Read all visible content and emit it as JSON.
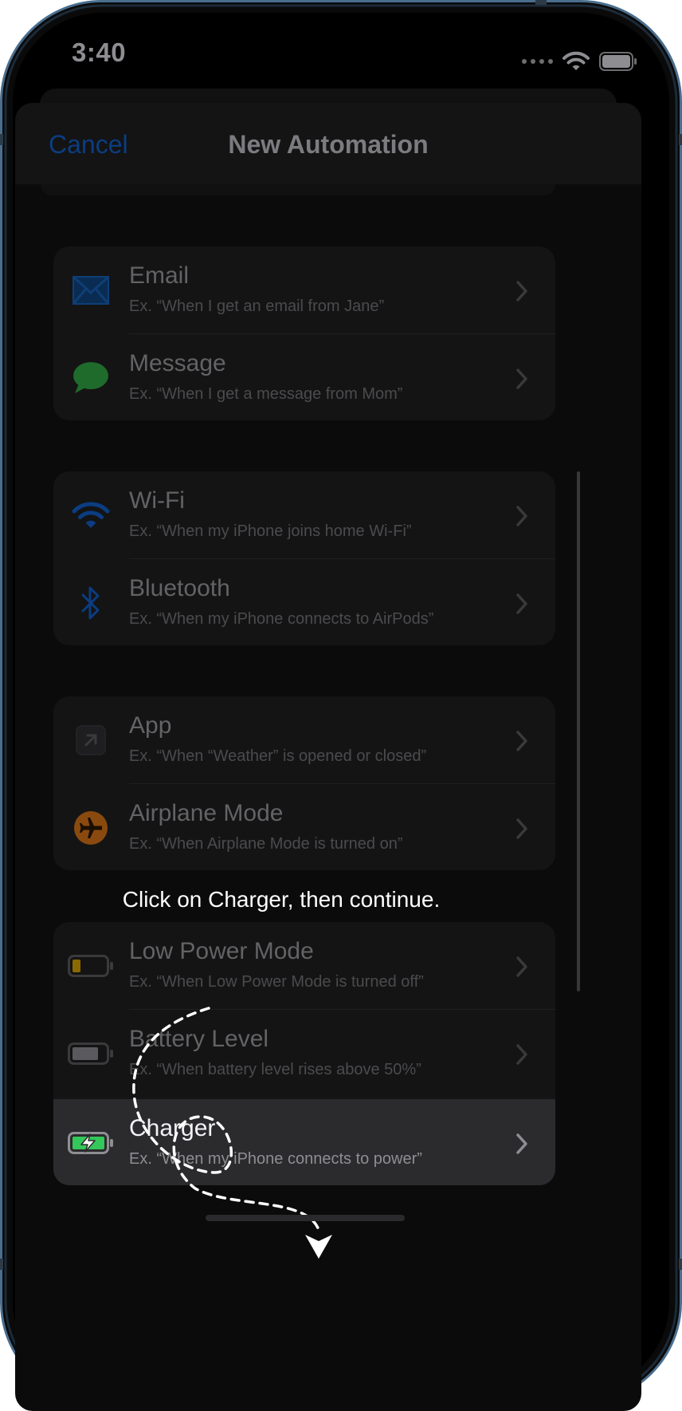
{
  "status_bar": {
    "time": "3:40"
  },
  "nav": {
    "cancel_label": "Cancel",
    "title": "New Automation"
  },
  "groups": [
    {
      "rows": [
        {
          "title": "Email",
          "subtitle": "Ex. “When I get an email from Jane”",
          "icon": "mail-icon"
        },
        {
          "title": "Message",
          "subtitle": "Ex. “When I get a message from Mom”",
          "icon": "message-bubble-icon"
        }
      ]
    },
    {
      "rows": [
        {
          "title": "Wi-Fi",
          "subtitle": "Ex. “When my iPhone joins home Wi-Fi”",
          "icon": "wifi-icon"
        },
        {
          "title": "Bluetooth",
          "subtitle": "Ex. “When my iPhone connects to AirPods”",
          "icon": "bluetooth-icon"
        }
      ]
    },
    {
      "rows": [
        {
          "title": "App",
          "subtitle": "Ex. “When “Weather” is opened or closed”",
          "icon": "app-arrow-icon"
        },
        {
          "title": "Airplane Mode",
          "subtitle": "Ex. “When Airplane Mode is turned on”",
          "icon": "airplane-icon"
        }
      ]
    },
    {
      "rows": [
        {
          "title": "Low Power Mode",
          "subtitle": "Ex. “When Low Power Mode is turned off”",
          "icon": "low-battery-icon"
        },
        {
          "title": "Battery Level",
          "subtitle": "Ex. “When battery level rises above 50%”",
          "icon": "battery-icon"
        },
        {
          "title": "Charger",
          "subtitle": "Ex. “When my iPhone connects to power”",
          "icon": "charging-battery-icon",
          "highlighted": true
        }
      ]
    }
  ],
  "instruction": "Click on Charger, then continue.",
  "colors": {
    "accent_blue": "#0b3d80",
    "message_green": "#1f6b2c",
    "airplane_orange": "#8a4a0f",
    "charger_green": "#34c759",
    "low_power_yellow": "#8a6a00",
    "frame_blue": "#4a6e8e"
  }
}
